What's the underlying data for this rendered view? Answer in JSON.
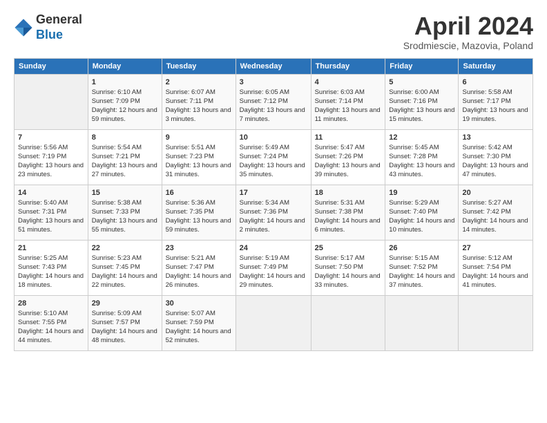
{
  "header": {
    "logo_line1": "General",
    "logo_line2": "Blue",
    "month": "April 2024",
    "location": "Srodmiescie, Mazovia, Poland"
  },
  "days_of_week": [
    "Sunday",
    "Monday",
    "Tuesday",
    "Wednesday",
    "Thursday",
    "Friday",
    "Saturday"
  ],
  "weeks": [
    [
      {
        "day": "",
        "empty": true
      },
      {
        "day": "1",
        "sunrise": "Sunrise: 6:10 AM",
        "sunset": "Sunset: 7:09 PM",
        "daylight": "Daylight: 12 hours and 59 minutes."
      },
      {
        "day": "2",
        "sunrise": "Sunrise: 6:07 AM",
        "sunset": "Sunset: 7:11 PM",
        "daylight": "Daylight: 13 hours and 3 minutes."
      },
      {
        "day": "3",
        "sunrise": "Sunrise: 6:05 AM",
        "sunset": "Sunset: 7:12 PM",
        "daylight": "Daylight: 13 hours and 7 minutes."
      },
      {
        "day": "4",
        "sunrise": "Sunrise: 6:03 AM",
        "sunset": "Sunset: 7:14 PM",
        "daylight": "Daylight: 13 hours and 11 minutes."
      },
      {
        "day": "5",
        "sunrise": "Sunrise: 6:00 AM",
        "sunset": "Sunset: 7:16 PM",
        "daylight": "Daylight: 13 hours and 15 minutes."
      },
      {
        "day": "6",
        "sunrise": "Sunrise: 5:58 AM",
        "sunset": "Sunset: 7:17 PM",
        "daylight": "Daylight: 13 hours and 19 minutes."
      }
    ],
    [
      {
        "day": "7",
        "sunrise": "Sunrise: 5:56 AM",
        "sunset": "Sunset: 7:19 PM",
        "daylight": "Daylight: 13 hours and 23 minutes."
      },
      {
        "day": "8",
        "sunrise": "Sunrise: 5:54 AM",
        "sunset": "Sunset: 7:21 PM",
        "daylight": "Daylight: 13 hours and 27 minutes."
      },
      {
        "day": "9",
        "sunrise": "Sunrise: 5:51 AM",
        "sunset": "Sunset: 7:23 PM",
        "daylight": "Daylight: 13 hours and 31 minutes."
      },
      {
        "day": "10",
        "sunrise": "Sunrise: 5:49 AM",
        "sunset": "Sunset: 7:24 PM",
        "daylight": "Daylight: 13 hours and 35 minutes."
      },
      {
        "day": "11",
        "sunrise": "Sunrise: 5:47 AM",
        "sunset": "Sunset: 7:26 PM",
        "daylight": "Daylight: 13 hours and 39 minutes."
      },
      {
        "day": "12",
        "sunrise": "Sunrise: 5:45 AM",
        "sunset": "Sunset: 7:28 PM",
        "daylight": "Daylight: 13 hours and 43 minutes."
      },
      {
        "day": "13",
        "sunrise": "Sunrise: 5:42 AM",
        "sunset": "Sunset: 7:30 PM",
        "daylight": "Daylight: 13 hours and 47 minutes."
      }
    ],
    [
      {
        "day": "14",
        "sunrise": "Sunrise: 5:40 AM",
        "sunset": "Sunset: 7:31 PM",
        "daylight": "Daylight: 13 hours and 51 minutes."
      },
      {
        "day": "15",
        "sunrise": "Sunrise: 5:38 AM",
        "sunset": "Sunset: 7:33 PM",
        "daylight": "Daylight: 13 hours and 55 minutes."
      },
      {
        "day": "16",
        "sunrise": "Sunrise: 5:36 AM",
        "sunset": "Sunset: 7:35 PM",
        "daylight": "Daylight: 13 hours and 59 minutes."
      },
      {
        "day": "17",
        "sunrise": "Sunrise: 5:34 AM",
        "sunset": "Sunset: 7:36 PM",
        "daylight": "Daylight: 14 hours and 2 minutes."
      },
      {
        "day": "18",
        "sunrise": "Sunrise: 5:31 AM",
        "sunset": "Sunset: 7:38 PM",
        "daylight": "Daylight: 14 hours and 6 minutes."
      },
      {
        "day": "19",
        "sunrise": "Sunrise: 5:29 AM",
        "sunset": "Sunset: 7:40 PM",
        "daylight": "Daylight: 14 hours and 10 minutes."
      },
      {
        "day": "20",
        "sunrise": "Sunrise: 5:27 AM",
        "sunset": "Sunset: 7:42 PM",
        "daylight": "Daylight: 14 hours and 14 minutes."
      }
    ],
    [
      {
        "day": "21",
        "sunrise": "Sunrise: 5:25 AM",
        "sunset": "Sunset: 7:43 PM",
        "daylight": "Daylight: 14 hours and 18 minutes."
      },
      {
        "day": "22",
        "sunrise": "Sunrise: 5:23 AM",
        "sunset": "Sunset: 7:45 PM",
        "daylight": "Daylight: 14 hours and 22 minutes."
      },
      {
        "day": "23",
        "sunrise": "Sunrise: 5:21 AM",
        "sunset": "Sunset: 7:47 PM",
        "daylight": "Daylight: 14 hours and 26 minutes."
      },
      {
        "day": "24",
        "sunrise": "Sunrise: 5:19 AM",
        "sunset": "Sunset: 7:49 PM",
        "daylight": "Daylight: 14 hours and 29 minutes."
      },
      {
        "day": "25",
        "sunrise": "Sunrise: 5:17 AM",
        "sunset": "Sunset: 7:50 PM",
        "daylight": "Daylight: 14 hours and 33 minutes."
      },
      {
        "day": "26",
        "sunrise": "Sunrise: 5:15 AM",
        "sunset": "Sunset: 7:52 PM",
        "daylight": "Daylight: 14 hours and 37 minutes."
      },
      {
        "day": "27",
        "sunrise": "Sunrise: 5:12 AM",
        "sunset": "Sunset: 7:54 PM",
        "daylight": "Daylight: 14 hours and 41 minutes."
      }
    ],
    [
      {
        "day": "28",
        "sunrise": "Sunrise: 5:10 AM",
        "sunset": "Sunset: 7:55 PM",
        "daylight": "Daylight: 14 hours and 44 minutes."
      },
      {
        "day": "29",
        "sunrise": "Sunrise: 5:09 AM",
        "sunset": "Sunset: 7:57 PM",
        "daylight": "Daylight: 14 hours and 48 minutes."
      },
      {
        "day": "30",
        "sunrise": "Sunrise: 5:07 AM",
        "sunset": "Sunset: 7:59 PM",
        "daylight": "Daylight: 14 hours and 52 minutes."
      },
      {
        "day": "",
        "empty": true
      },
      {
        "day": "",
        "empty": true
      },
      {
        "day": "",
        "empty": true
      },
      {
        "day": "",
        "empty": true
      }
    ]
  ]
}
